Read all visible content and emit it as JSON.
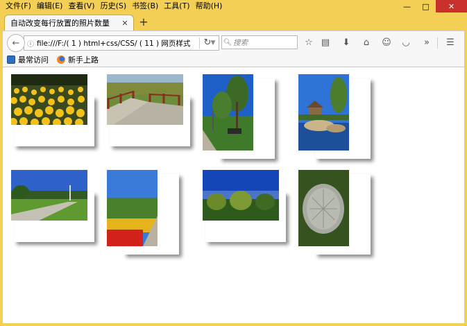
{
  "menu": {
    "items": [
      "文件(F)",
      "编辑(E)",
      "查看(V)",
      "历史(S)",
      "书签(B)",
      "工具(T)",
      "帮助(H)"
    ]
  },
  "window_controls": {
    "minimize": "—",
    "maximize": "□",
    "close": "✕"
  },
  "tab": {
    "title": "自动改变每行放置的照片数量",
    "close": "✕",
    "new_tab": "+"
  },
  "toolbar": {
    "url": "file:///F:/( 1 ) html+css/CSS/ ( 11 ) 网页样式",
    "search_placeholder": "搜索"
  },
  "bookmarks": {
    "items": [
      "最常访问",
      "新手上路"
    ]
  },
  "photos": [
    {
      "subject": "yellow-flowers"
    },
    {
      "subject": "wooden-bridge"
    },
    {
      "subject": "park-bench-trees"
    },
    {
      "subject": "pavilion-lake"
    },
    {
      "subject": "park-path"
    },
    {
      "subject": "red-flowers-path"
    },
    {
      "subject": "blue-sky-trees"
    },
    {
      "subject": "manhole-grass"
    }
  ],
  "colors": {
    "frame": "#f3cf55",
    "close_button": "#c9302c",
    "content_bg": "#ffffff"
  }
}
